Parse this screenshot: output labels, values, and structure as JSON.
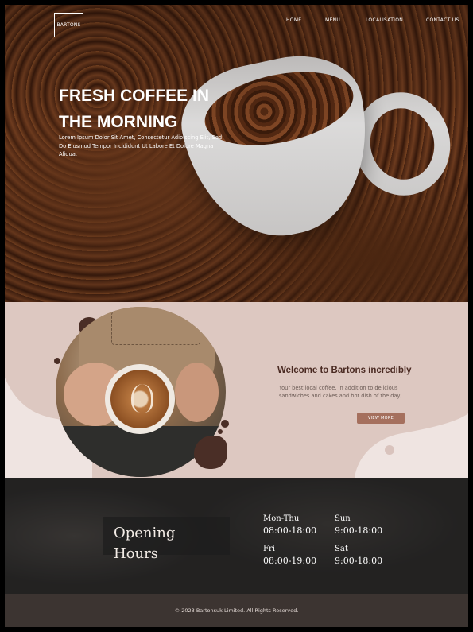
{
  "brand": {
    "logo_text": "BARTONS"
  },
  "nav": {
    "items": [
      {
        "label": "HOME"
      },
      {
        "label": "MENU"
      },
      {
        "label": "LOCALISATION"
      },
      {
        "label": "CONTACT US"
      }
    ]
  },
  "hero": {
    "title_line1": "FRESH COFFEE IN",
    "title_line2": "THE MORNING",
    "description": "Lorem Ipsum Dolor Sit Amet, Consectetur Adipiscing Elit, Sed Do Eiusmod Tempor Incididunt Ut Labore Et Dolore Magna Aliqua."
  },
  "welcome": {
    "title": "Welcome to Bartons incredibly",
    "text": "Your best local coffee. In addition to delicious sandwiches and cakes and hot dish of the day,",
    "button_label": "VIEW MORE"
  },
  "hours": {
    "title_line1": "Opening",
    "title_line2": "Hours",
    "schedule": [
      {
        "day": "Mon-Thu",
        "time": "08:00-18:00"
      },
      {
        "day": "Sun",
        "time": "9:00-18:00"
      },
      {
        "day": "Fri",
        "time": "08:00-19:00"
      },
      {
        "day": "Sat",
        "time": "9:00-18:00"
      }
    ]
  },
  "footer": {
    "copyright": "© 2023 Bartonsuk Limited. All Rights Reserved."
  },
  "colors": {
    "accent": "#a5705e",
    "welcome_bg": "#ddc8c1",
    "footer_bg": "#3c3431",
    "title_brown": "#4a2a22"
  }
}
